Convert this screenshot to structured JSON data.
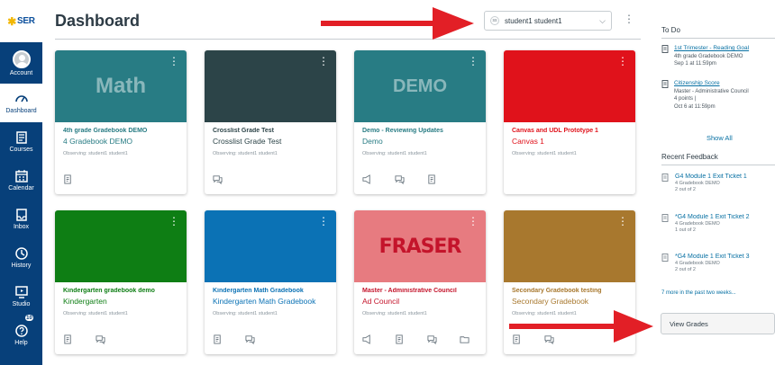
{
  "colors": {
    "nav_bg": "#07407a",
    "link": "#0770a3",
    "arrow": "#e21f26"
  },
  "nav": {
    "logo": "SER",
    "items": [
      {
        "label": "Account",
        "icon": "avatar-icon"
      },
      {
        "label": "Dashboard",
        "icon": "dashboard-icon"
      },
      {
        "label": "Courses",
        "icon": "courses-icon"
      },
      {
        "label": "Calendar",
        "icon": "calendar-icon"
      },
      {
        "label": "Inbox",
        "icon": "inbox-icon"
      },
      {
        "label": "History",
        "icon": "clock-icon"
      },
      {
        "label": "Studio",
        "icon": "studio-icon"
      },
      {
        "label": "Help",
        "icon": "help-icon",
        "badge": "10"
      }
    ]
  },
  "header": {
    "title": "Dashboard",
    "observer_selected": "student1 student1"
  },
  "cards": [
    {
      "hero_text": "Math",
      "color": "#287c84",
      "name": "4th grade Gradebook DEMO",
      "code": "4 Gradebook DEMO",
      "observing": "Observing: student1 student1"
    },
    {
      "hero_text": "",
      "color": "#2c4448",
      "name": "Crosslist Grade Test",
      "code": "Crosslist Grade Test",
      "observing": "Observing: student1 student1"
    },
    {
      "hero_text": "DEMO",
      "color": "#287c84",
      "name": "Demo - Reviewing Updates",
      "code": "Demo",
      "observing": "Observing: student1 student1"
    },
    {
      "hero_text": "",
      "color": "#e0121b",
      "name": "Canvas and UDL Prototype 1",
      "code": "Canvas 1",
      "observing": "Observing: student1 student1"
    },
    {
      "hero_text": "",
      "color": "#0e7e14",
      "name": "Kindergarten gradebook demo",
      "code": "Kindergarten",
      "observing": "Observing: student1 student1"
    },
    {
      "hero_text": "",
      "color": "#0b72b5",
      "name": "Kindergarten Math Gradebook",
      "code": "Kindergarten Math Gradebook",
      "observing": "Observing: student1 student1"
    },
    {
      "hero_text": "FRASER",
      "color": "#e77b80",
      "name": "Master - Administrative Council",
      "code": "Ad Council",
      "observing": "Observing: student1 student1"
    },
    {
      "hero_text": "",
      "color": "#a8782e",
      "name": "Secondary Gradebook testing",
      "code": "Secondary Gradebook",
      "observing": "Observing: student1 student1"
    }
  ],
  "sidebar": {
    "todo_heading": "To Do",
    "todos": [
      {
        "title": "1st Trimester - Reading Goal",
        "course": "4th grade Gradebook DEMO",
        "due": "Sep 1 at 11:59pm"
      },
      {
        "title": "Citizenship Score",
        "course": "Master - Administrative Council",
        "points": "4 points |",
        "due": "Oct 6 at 11:59pm"
      }
    ],
    "show_all": "Show All",
    "feedback_heading": "Recent Feedback",
    "feedback": [
      {
        "title": "G4 Module 1 Exit Ticket 1",
        "course": "4 Gradebook DEMO",
        "score": "2 out of 2"
      },
      {
        "title": "*G4 Module 1 Exit Ticket 2",
        "course": "4 Gradebook DEMO",
        "score": "1 out of 2"
      },
      {
        "title": "*G4 Module 1 Exit Ticket 3",
        "course": "4 Gradebook DEMO",
        "score": "2 out of 2"
      }
    ],
    "more": "7 more in the past two weeks...",
    "view_grades": "View Grades"
  }
}
